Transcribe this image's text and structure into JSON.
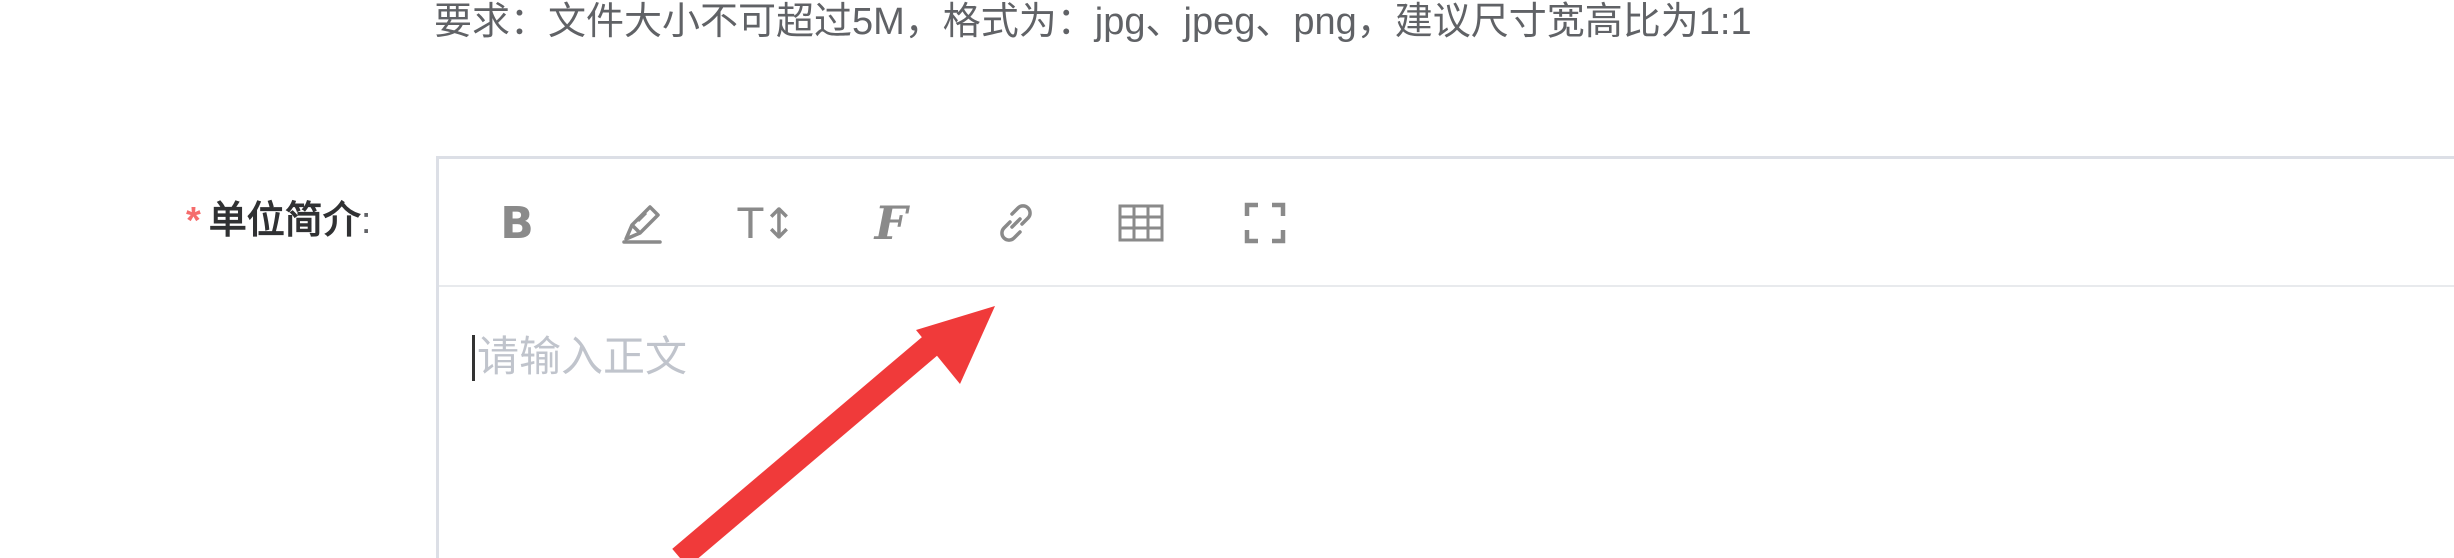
{
  "upload_hint": "要求：文件大小不可超过5M，格式为：jpg、jpeg、png，建议尺寸宽高比为1:1",
  "field": {
    "required_mark": "*",
    "label": "单位简介",
    "colon": ":"
  },
  "toolbar": {
    "bold": "B",
    "brush_icon": "brush-icon",
    "text_size": "T↕",
    "font": "F",
    "link_icon": "link-icon",
    "table_icon": "table-icon",
    "fullscreen_icon": "fullscreen-icon"
  },
  "editor": {
    "placeholder": "请输入正文"
  },
  "colors": {
    "required": "#f56c6c",
    "arrow": "#f03a3a",
    "icon": "#8a8a8a",
    "placeholder": "#c0c4cc",
    "border": "#dcdfe6"
  }
}
